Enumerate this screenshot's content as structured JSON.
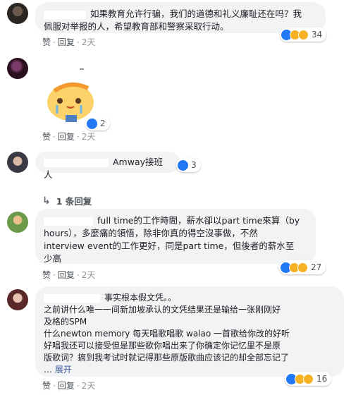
{
  "comments": [
    {
      "text": "如果教育允许行骗，我们的道德和礼义廉耻还在吗？我佩服对举报的人，希望教育部和警察采取行动。",
      "lines": [
        "如果教育允许行骗，我们的道德和礼义廉耻还在吗？我",
        "佩服对举报的人，希望教育部和警察采取行动。"
      ],
      "reactions": [
        "like",
        "haha",
        "wow"
      ],
      "reaction_count": "34",
      "actions": {
        "like": "赞",
        "reply": "回复",
        "time": "2天"
      }
    },
    {
      "sticker": "chick-crying-sticker",
      "reactions": [
        "like"
      ],
      "reaction_count": "2",
      "actions": {
        "like": "赞",
        "reply": "回复",
        "time": "2天"
      }
    },
    {
      "text": "Amway接班人",
      "reactions": [
        "like"
      ],
      "reaction_count": "3",
      "replies_label": "1 条回复"
    },
    {
      "lines": [
        "full time的工作時間，薪水卻以part time來算（by",
        "hours），多麼痛的領悟，除非你真的得空沒事做，不然",
        "interview event的工作更好，同是part time，但後者的薪水至",
        "少高"
      ],
      "reactions": [
        "like",
        "haha",
        "wow"
      ],
      "reaction_count": "27",
      "actions": {
        "like": "赞",
        "reply": "回复",
        "time": "2天"
      }
    },
    {
      "lines": [
        "事实根本假文凭。。",
        "之前讲什么唯一一间新加坡承认的文凭结果还是输给一张刚刚好",
        "及格的SPM",
        "什么newton memory 每天唱歌唱歌 walao 一首歌给你改的好听",
        "好唱我还可以接受但是那些歌你唱出来了你确定你记忆里不是原",
        "版歌词？搞到我考试时就记得那些原版歌曲应该记的却全部忘记了",
        "…"
      ],
      "see_more": "展开",
      "reactions": [
        "like",
        "haha",
        "wow"
      ],
      "reaction_count": "16",
      "actions": {
        "like": "赞",
        "reply": "回复",
        "time": "2天"
      }
    }
  ],
  "colors": {
    "like_blue": "#2078f4",
    "haha_yellow": "#f7b125",
    "bubble_bg": "#f2f3f5",
    "link": "#385898"
  }
}
